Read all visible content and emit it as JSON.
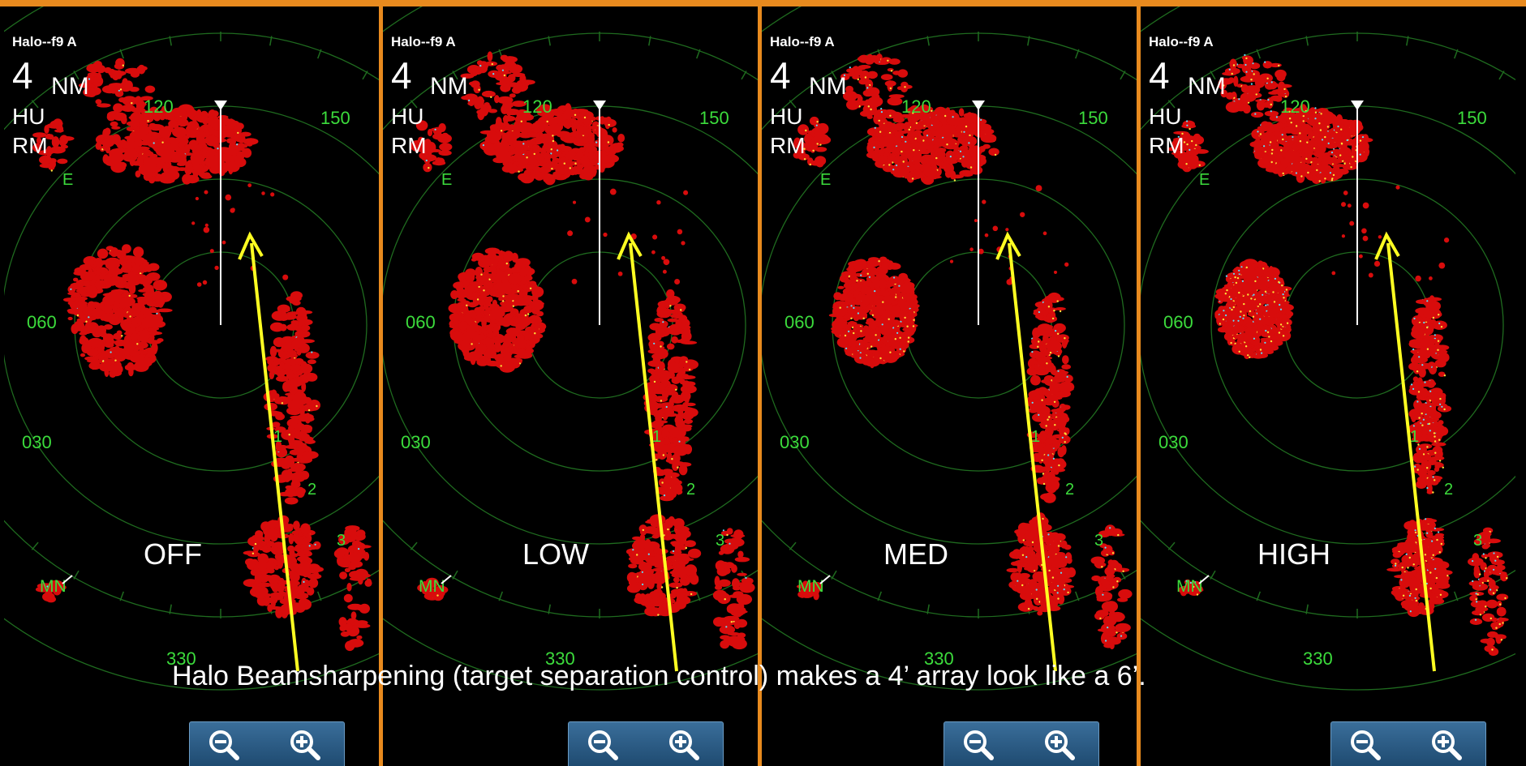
{
  "panels": [
    {
      "title": "Halo--f9 A",
      "range": "4",
      "unit": "NM",
      "mode1": "HU",
      "mode2": "RM",
      "setting": "OFF",
      "bearings": {
        "b120": "120",
        "b150": "150",
        "b060": "060",
        "b030": "030",
        "b330": "330",
        "east": "E",
        "mn": "MN"
      },
      "rings": [
        "1",
        "2",
        "3"
      ]
    },
    {
      "title": "Halo--f9 A",
      "range": "4",
      "unit": "NM",
      "mode1": "HU",
      "mode2": "RM",
      "setting": "LOW",
      "bearings": {
        "b120": "120",
        "b150": "150",
        "b060": "060",
        "b030": "030",
        "b330": "330",
        "east": "E",
        "mn": "MN"
      },
      "rings": [
        "1",
        "2",
        "3"
      ]
    },
    {
      "title": "Halo--f9 A",
      "range": "4",
      "unit": "NM",
      "mode1": "HU",
      "mode2": "RM",
      "setting": "MED",
      "bearings": {
        "b120": "120",
        "b150": "150",
        "b060": "060",
        "b030": "030",
        "b330": "330",
        "east": "E",
        "mn": "MN"
      },
      "rings": [
        "1",
        "2",
        "3"
      ]
    },
    {
      "title": "Halo--f9 A",
      "range": "4",
      "unit": "NM",
      "mode1": "HU",
      "mode2": "RM",
      "setting": "HIGH",
      "bearings": {
        "b120": "120",
        "b150": "150",
        "b060": "060",
        "b030": "030",
        "b330": "330",
        "east": "E",
        "mn": "MN"
      },
      "rings": [
        "1",
        "2",
        "3"
      ]
    }
  ],
  "caption": "Halo Beamsharpening (target separation control) makes a 4’ array look like a 6’.",
  "icons": {
    "zoom_out": "zoom-out-icon",
    "zoom_in": "zoom-in-icon"
  },
  "colors": {
    "echo": "#d80c0c",
    "range_ring": "#1f6b1f",
    "label_green": "#3cdc3c",
    "frame": "#e88a1e",
    "arrow": "#ffff22"
  }
}
